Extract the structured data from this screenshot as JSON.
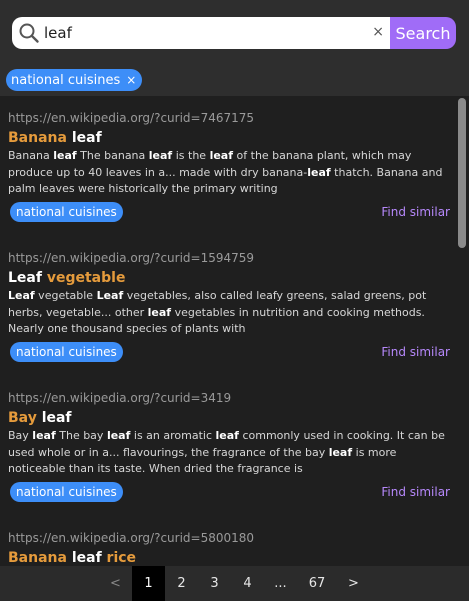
{
  "search": {
    "query": "leaf",
    "button_label": "Search",
    "clear_label": "×"
  },
  "active_filter": {
    "label": "national cuisines",
    "remove_label": "×"
  },
  "results": [
    {
      "url": "https://en.wikipedia.org/?curid=7467175",
      "title_pre": "Banana ",
      "title_em": "leaf",
      "title_post": "",
      "snippet_html": "Banana <b>leaf</b> The banana <b>leaf</b> is the <b>leaf</b> of the banana plant, which may produce up to 40 leaves in a... made with dry banana-<b>leaf</b> thatch. Banana and palm leaves were historically the primary writing",
      "tag": "national cuisines",
      "similar": "Find similar"
    },
    {
      "url": "https://en.wikipedia.org/?curid=1594759",
      "title_pre": "",
      "title_em": "Leaf",
      "title_post": " vegetable",
      "snippet_html": "<b>Leaf</b> vegetable <b>Leaf</b> vegetables, also called leafy greens, salad greens, pot herbs, vegetable... other <b>leaf</b> vegetables in nutrition and cooking methods. Nearly one thousand species of plants with",
      "tag": "national cuisines",
      "similar": "Find similar"
    },
    {
      "url": "https://en.wikipedia.org/?curid=3419",
      "title_pre": "Bay ",
      "title_em": "leaf",
      "title_post": "",
      "snippet_html": "Bay <b>leaf</b> The bay <b>leaf</b> is an aromatic <b>leaf</b> commonly used in cooking. It can be used whole or in a... flavourings, the fragrance of the bay <b>leaf</b> is more noticeable than its taste. When dried the fragrance is",
      "tag": "national cuisines",
      "similar": "Find similar"
    },
    {
      "url": "https://en.wikipedia.org/?curid=5800180",
      "title_pre": "Banana ",
      "title_em": "leaf",
      "title_post": " rice",
      "snippet_html": "",
      "tag": "",
      "similar": ""
    }
  ],
  "pagination": {
    "prev": "<",
    "pages": [
      "1",
      "2",
      "3",
      "4",
      "...",
      "67"
    ],
    "next": ">",
    "current": "1"
  },
  "colors": {
    "accent": "#a06cf7",
    "tag": "#3d8ef8",
    "title": "#e59b3c",
    "link": "#b688fb"
  }
}
